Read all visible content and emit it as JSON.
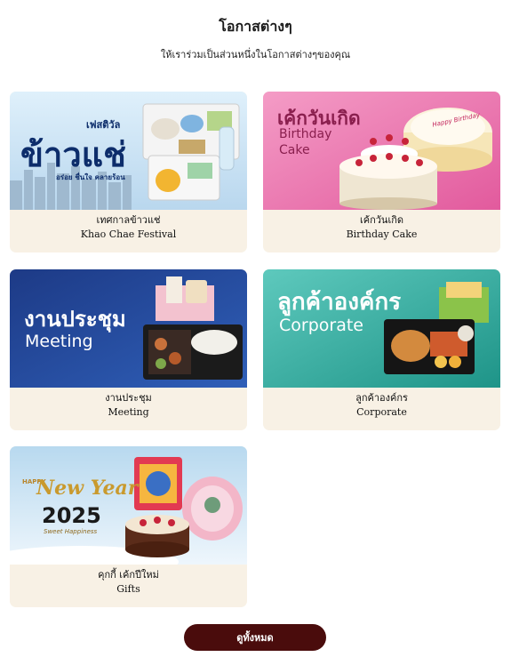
{
  "header": {
    "title": "โอกาสต่างๆ",
    "subtitle": "ให้เราร่วมเป็นส่วนหนึ่งในโอกาสต่างๆของคุณ"
  },
  "cards": [
    {
      "image_text": {
        "small": "เฟสติวัล",
        "big": "ข้าวแช่",
        "tag": "อร่อย ชื่นใจ คลายร้อน"
      },
      "label_th": "เทศกาลข้าวแช่",
      "label_en": "Khao Chae Festival"
    },
    {
      "image_text": {
        "line1": "เค้กวันเกิด",
        "line2": "Birthday",
        "line3": "Cake",
        "plaque": "Happy Birthday"
      },
      "label_th": "เค้กวันเกิด",
      "label_en": "Birthday Cake"
    },
    {
      "image_text": {
        "line1": "งานประชุม",
        "line2": "Meeting"
      },
      "label_th": "งานประชุม",
      "label_en": "Meeting"
    },
    {
      "image_text": {
        "line1": "ลูกค้าองค์กร",
        "line2": "Corporate"
      },
      "label_th": "ลูกค้าองค์กร",
      "label_en": "Corporate"
    },
    {
      "image_text": {
        "happy": "HAPPY",
        "new_year": "New Year",
        "year": "2025",
        "tagline": "Sweet Happiness"
      },
      "label_th": "คุกกี้ เค้กปีใหม่",
      "label_en": "Gifts"
    }
  ],
  "footer": {
    "view_all_label": "ดูทั้งหมด"
  },
  "colors": {
    "button_bg": "#4a0c0c",
    "caption_bg": "#f8f1e5"
  }
}
